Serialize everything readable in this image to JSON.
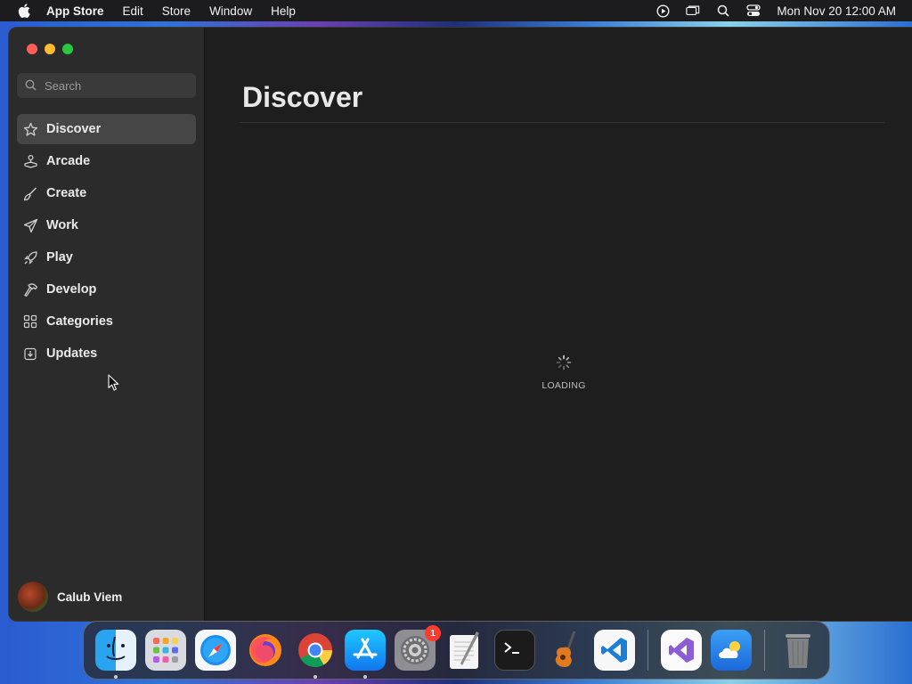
{
  "menubar": {
    "apple_icon": "apple-logo",
    "items": [
      {
        "label": "App Store",
        "bold": true
      },
      {
        "label": "Edit"
      },
      {
        "label": "Store"
      },
      {
        "label": "Window"
      },
      {
        "label": "Help"
      }
    ],
    "status_icons": [
      "screen-recording-icon",
      "window-mirroring-icon",
      "spotlight-search-icon",
      "control-center-icon"
    ],
    "clock": "Mon Nov 20  12:00 AM"
  },
  "window": {
    "traffic_lights": [
      "close",
      "minimize",
      "zoom"
    ],
    "search": {
      "placeholder": "Search",
      "value": ""
    },
    "sidebar": {
      "items": [
        {
          "label": "Discover",
          "icon": "star-icon",
          "active": true
        },
        {
          "label": "Arcade",
          "icon": "joystick-icon"
        },
        {
          "label": "Create",
          "icon": "paintbrush-icon"
        },
        {
          "label": "Work",
          "icon": "paperplane-icon"
        },
        {
          "label": "Play",
          "icon": "rocket-icon"
        },
        {
          "label": "Develop",
          "icon": "hammer-icon"
        },
        {
          "label": "Categories",
          "icon": "grid-icon"
        },
        {
          "label": "Updates",
          "icon": "download-icon"
        }
      ]
    },
    "profile": {
      "name": "Calub Viem"
    },
    "main": {
      "title": "Discover",
      "loading_label": "LOADING"
    }
  },
  "dock": {
    "apps": [
      {
        "name": "Finder",
        "running": true
      },
      {
        "name": "Launchpad"
      },
      {
        "name": "Safari"
      },
      {
        "name": "Firefox"
      },
      {
        "name": "Google Chrome",
        "running": true
      },
      {
        "name": "App Store",
        "running": true
      },
      {
        "name": "System Settings",
        "badge": "1"
      },
      {
        "name": "TextEdit"
      },
      {
        "name": "Terminal"
      },
      {
        "name": "GarageBand"
      },
      {
        "name": "Visual Studio Code"
      }
    ],
    "recent_apps": [
      {
        "name": "Visual Studio"
      },
      {
        "name": "Weather"
      }
    ],
    "trash": {
      "name": "Trash"
    }
  }
}
